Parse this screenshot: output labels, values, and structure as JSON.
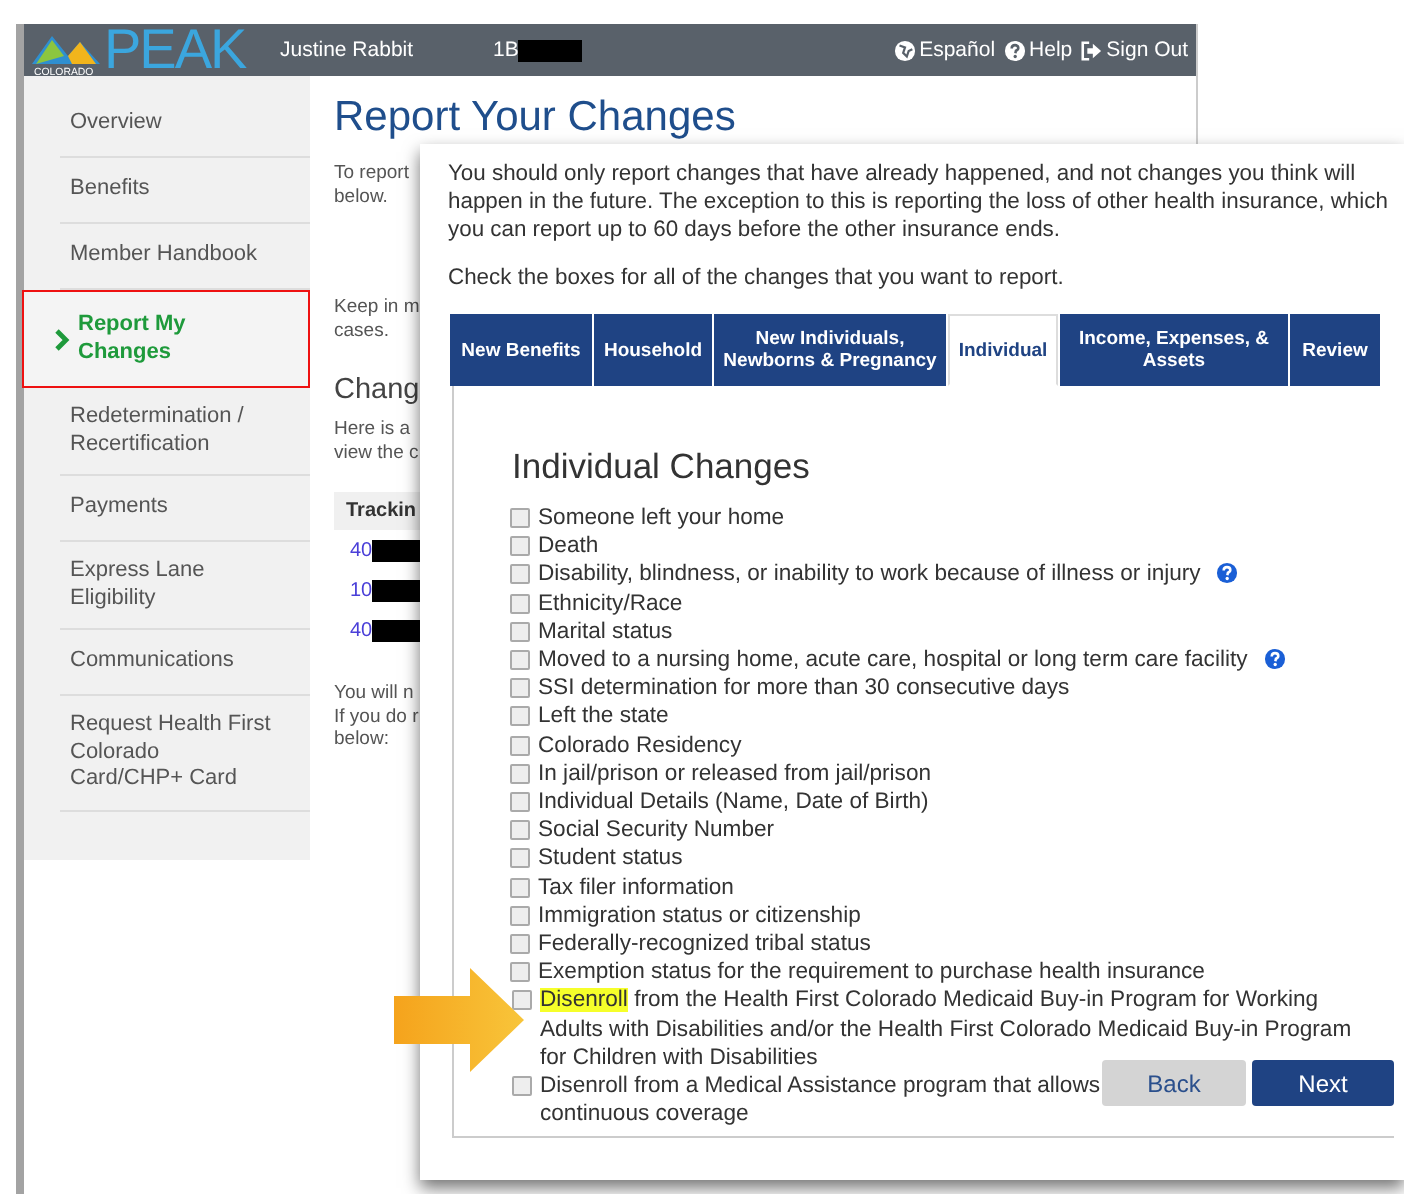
{
  "header": {
    "logo_word": "PEAK",
    "logo_sub": "COLORADO",
    "user_name": "Justine Rabbit",
    "case_id": "1B",
    "links": [
      {
        "kind": "globe",
        "label": "Español"
      },
      {
        "kind": "help",
        "label": "Help"
      },
      {
        "kind": "signout",
        "label": "Sign Out"
      }
    ]
  },
  "sidebar": {
    "items": [
      {
        "label": "Overview",
        "selected": false
      },
      {
        "label": "Benefits",
        "selected": false
      },
      {
        "label": "Member Handbook",
        "selected": false
      },
      {
        "label": "Report My Changes",
        "selected": true
      },
      {
        "label": "Redetermination / Recertification",
        "selected": false
      },
      {
        "label": "Payments",
        "selected": false
      },
      {
        "label": "Express Lane Eligibility",
        "selected": false
      },
      {
        "label": "Communications",
        "selected": false
      },
      {
        "label": "Request Health First Colorado Card/CHP+ Card",
        "selected": false
      }
    ]
  },
  "page": {
    "title": "Report Your Changes",
    "intro": [
      "To report",
      "below."
    ],
    "note": [
      "Keep in m",
      "cases."
    ],
    "section_title": "Chang",
    "section_text": [
      "Here is a",
      "view the c"
    ],
    "table": {
      "column_1": "Trackin",
      "rows": [
        "40",
        "10",
        "40"
      ]
    },
    "footer_text": [
      "You will n",
      "If you do r",
      "below:"
    ]
  },
  "dialog": {
    "intro": "You should only report changes that have already happened, and not changes you think will happen in the future. The exception to this is reporting the loss of other health insurance, which you can report up to 60 days before the other insurance ends.",
    "instruction": "Check the boxes for all of the changes that you want to report.",
    "tabs": [
      {
        "label": "New Benefits",
        "selected": false
      },
      {
        "label": "Household",
        "selected": false
      },
      {
        "label": "New Individuals, Newborns & Pregnancy",
        "selected": false
      },
      {
        "label": "Individual",
        "selected": true
      },
      {
        "label": "Income, Expenses, & Assets",
        "selected": false
      },
      {
        "label": "Review",
        "selected": false
      }
    ],
    "section_title": "Individual Changes",
    "items": [
      {
        "label": "Someone left your home",
        "checked": false,
        "help": false
      },
      {
        "label": "Death",
        "checked": false,
        "help": false
      },
      {
        "label": "Disability, blindness, or inability to work because of illness or injury",
        "checked": false,
        "help": true
      },
      {
        "label": "Ethnicity/Race",
        "checked": false,
        "help": false
      },
      {
        "label": "Marital status",
        "checked": false,
        "help": false
      },
      {
        "label": "Moved to a nursing home, acute care, hospital or long term care facility",
        "checked": false,
        "help": true
      },
      {
        "label": "SSI determination for more than 30 consecutive days",
        "checked": false,
        "help": false
      },
      {
        "label": "Left the state",
        "checked": false,
        "help": false
      },
      {
        "label": "Colorado Residency",
        "checked": false,
        "help": false
      },
      {
        "label": "In jail/prison or released from jail/prison",
        "checked": false,
        "help": false
      },
      {
        "label": "Individual Details (Name, Date of Birth)",
        "checked": false,
        "help": false
      },
      {
        "label": "Social Security Number",
        "checked": false,
        "help": false
      },
      {
        "label": "Student status",
        "checked": false,
        "help": false
      },
      {
        "label": "Tax filer information",
        "checked": false,
        "help": false
      },
      {
        "label": "Immigration status or citizenship",
        "checked": false,
        "help": false
      },
      {
        "label": "Federally-recognized tribal status",
        "checked": false,
        "help": false
      },
      {
        "label": "Exemption status for the requirement to purchase health insurance",
        "checked": false,
        "help": false
      },
      {
        "highlight": "Disenroll",
        "label": " from the Health First Colorado Medicaid Buy-in Program for Working Adults with Disabilities and/or the Health First Colorado Medicaid Buy-in Program for Children with Disabilities",
        "checked": false,
        "help": false
      },
      {
        "label": "Disenroll from a Medical Assistance program that allows",
        "continued": "continuous coverage",
        "checked": false,
        "help": false
      }
    ],
    "buttons": [
      {
        "kind": "secondary",
        "label": "Back"
      },
      {
        "kind": "primary",
        "label": "Next"
      }
    ]
  }
}
